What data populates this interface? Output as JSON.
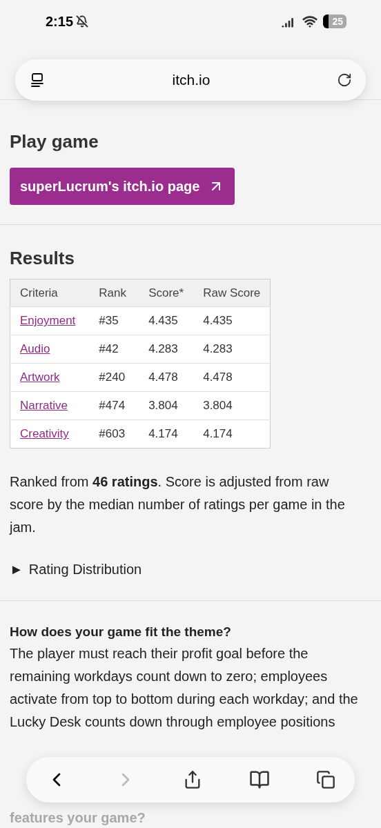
{
  "status_bar": {
    "time": "2:15",
    "battery": "25"
  },
  "address_bar": {
    "url": "itch.io"
  },
  "play_game": {
    "heading": "Play game",
    "button": "superLucrum's itch.io page"
  },
  "results": {
    "heading": "Results",
    "table": {
      "columns": [
        "Criteria",
        "Rank",
        "Score*",
        "Raw Score"
      ],
      "rows": [
        {
          "criteria": "Enjoyment",
          "rank": "#35",
          "score": "4.435",
          "raw_score": "4.435"
        },
        {
          "criteria": "Audio",
          "rank": "#42",
          "score": "4.283",
          "raw_score": "4.283"
        },
        {
          "criteria": "Artwork",
          "rank": "#240",
          "score": "4.478",
          "raw_score": "4.478"
        },
        {
          "criteria": "Narrative",
          "rank": "#474",
          "score": "3.804",
          "raw_score": "3.804"
        },
        {
          "criteria": "Creativity",
          "rank": "#603",
          "score": "4.174",
          "raw_score": "4.174"
        }
      ]
    },
    "summary": "Ranked from **46 ratings**. Score is adjusted from raw score by the median number of ratings per game in the jam.",
    "distribution": {
      "marker": "►",
      "label": "Rating Distribution",
      "expanded": false
    }
  },
  "questions": [
    {
      "question": "How does your game fit the theme?",
      "answer": "The player must reach their profit goal before the remaining workdays count down to zero; employees activate from top to bottom during each workday; and the Lucky Desk counts down through employee positions"
    },
    {
      "question": "features your game?"
    }
  ],
  "toolbar": {
    "back_enabled": true,
    "forward_enabled": false
  }
}
